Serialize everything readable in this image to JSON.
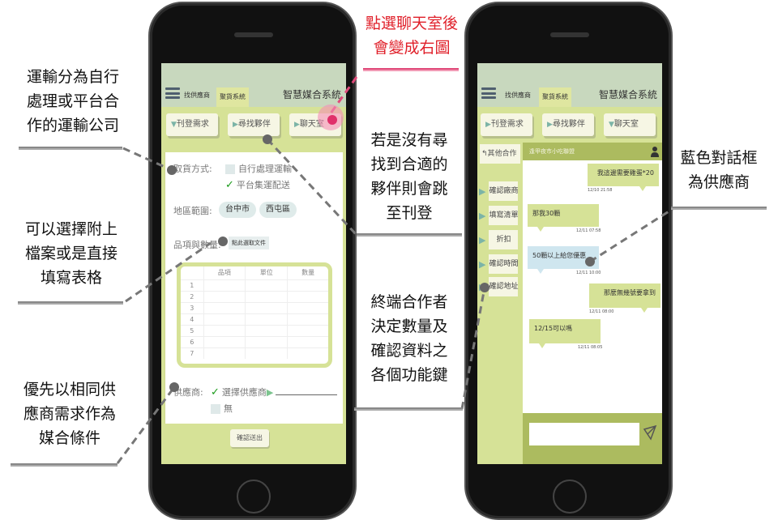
{
  "annotations": {
    "transport": [
      "運輸分為自行",
      "處理或平台合",
      "作的運輸公司"
    ],
    "attach": [
      "可以選擇附上",
      "檔案或是直接",
      "填寫表格"
    ],
    "priority": [
      "優先以相同供",
      "應商需求作為",
      "媒合條件"
    ],
    "chat_click": [
      "點選聊天室後",
      "會變成右圖"
    ],
    "no_partner": [
      "若是沒有尋",
      "找到合適的",
      "夥伴則會跳",
      "至刊登"
    ],
    "terminal": [
      "終端合作者",
      "決定數量及",
      "確認資料之",
      "各個功能鍵"
    ],
    "blue_box": [
      "藍色對話框",
      "為供應商"
    ]
  },
  "left_phone": {
    "tabs": [
      "找供應商",
      "聚貨系統"
    ],
    "active_tab": "聚貨系統",
    "app_title": "智慧媒合系統",
    "nav_buttons": [
      {
        "icon": "▼",
        "label": "刊登需求"
      },
      {
        "icon": "▶",
        "label": "尋找夥伴"
      },
      {
        "icon": "▶",
        "label": "聊天室"
      }
    ],
    "form": {
      "pickup_label": "取貨方式:",
      "pickup_options": [
        {
          "label": "自行處理運輸",
          "checked": false
        },
        {
          "label": "平台集運配送",
          "checked": true
        }
      ],
      "region_label": "地區範圍:",
      "regions": [
        "台中市",
        "西屯區"
      ],
      "items_label": "品項與數量:",
      "file_button": "點此選取文件",
      "table_headers": [
        "",
        "品項",
        "單位",
        "數量"
      ],
      "table_rows": [
        "1",
        "2",
        "3",
        "4",
        "5",
        "6",
        "7"
      ],
      "supplier_label": "供應商:",
      "supplier_options": [
        {
          "label": "選擇供應商",
          "checked": true
        },
        {
          "label": "無",
          "checked": false
        }
      ],
      "submit": "確認送出"
    }
  },
  "right_phone": {
    "tabs": [
      "找供應商",
      "聚貨系統"
    ],
    "active_tab": "聚貨系統",
    "app_title": "智慧媒合系統",
    "nav_buttons": [
      {
        "icon": "▶",
        "label": "刊登需求"
      },
      {
        "icon": "▶",
        "label": "尋找夥伴"
      },
      {
        "icon": "▼",
        "label": "聊天室"
      }
    ],
    "back_label": "其他合作",
    "chat_title": "逢甲夜市小吃聯盟",
    "side_items": [
      "確認廠商",
      "填寫清單",
      "折扣",
      "確認時間",
      "確認地址"
    ],
    "messages": [
      {
        "text": "我這邊需要雞蛋*20",
        "time": "12/10 21:58",
        "side": "right",
        "color": "green"
      },
      {
        "text": "那我30顆",
        "time": "12/11 07:58",
        "side": "left",
        "color": "green"
      },
      {
        "text": "50顆以上給您優惠",
        "time": "12/11 10:00",
        "side": "left",
        "color": "blue"
      },
      {
        "text": "那麼無幾號要拿到",
        "time": "12/11 08:00",
        "side": "right",
        "color": "green"
      },
      {
        "text": "12/15可以嗎",
        "time": "12/11 08:05",
        "side": "left",
        "color": "green"
      }
    ],
    "message_input": ""
  }
}
